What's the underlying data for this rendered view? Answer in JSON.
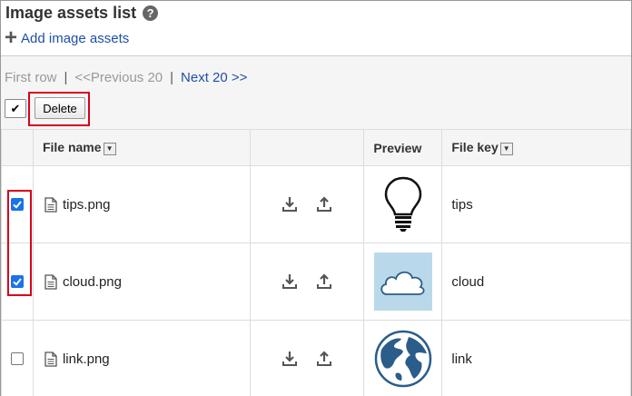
{
  "header": {
    "title": "Image assets list",
    "help_icon": "help-icon"
  },
  "add_link": {
    "icon": "plus-icon",
    "label": "Add image assets"
  },
  "pager": {
    "first": "First row",
    "sep1": "|",
    "prev": "<<Previous 20",
    "sep2": "|",
    "next": "Next 20 >>"
  },
  "toolbar": {
    "select_all_mark": "✔",
    "delete_label": "Delete"
  },
  "table": {
    "headers": {
      "select": "",
      "file_name": "File name",
      "actions": "",
      "preview": "Preview",
      "file_key": "File key"
    },
    "rows": [
      {
        "checked": true,
        "file_name": "tips.png",
        "preview_icon": "lightbulb-icon",
        "file_key": "tips"
      },
      {
        "checked": true,
        "file_name": "cloud.png",
        "preview_icon": "cloud-icon",
        "file_key": "cloud"
      },
      {
        "checked": false,
        "file_name": "link.png",
        "preview_icon": "globe-icon",
        "file_key": "link"
      }
    ]
  },
  "colors": {
    "link": "#1f4fa8",
    "highlight": "#d9001b",
    "checkbox_checked": "#1a73e8",
    "preview_cloud_bg": "#b9d9ea",
    "globe_blue": "#2a5d8a"
  }
}
